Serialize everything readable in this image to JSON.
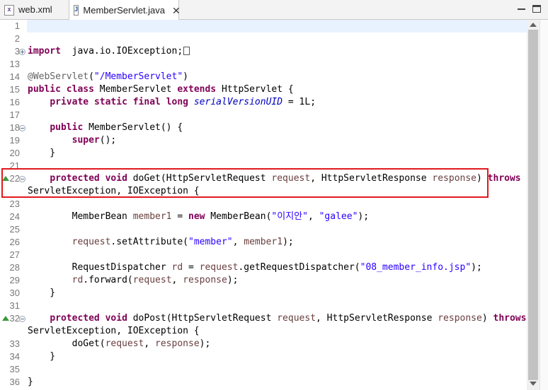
{
  "tabs": [
    {
      "label": "web.xml",
      "icon": "xml-file-icon",
      "active": false
    },
    {
      "label": "MemberServlet.java",
      "icon": "java-file-icon",
      "active": true
    }
  ],
  "lines": [
    {
      "n": "1"
    },
    {
      "n": "2"
    },
    {
      "n": "3",
      "segs": [
        [
          "kw",
          "import"
        ],
        [
          "",
          "  java.io.IOException;"
        ]
      ]
    },
    {
      "n": "13"
    },
    {
      "n": "14",
      "segs": [
        [
          "ann",
          "@WebServlet"
        ],
        [
          "",
          "("
        ],
        [
          "str",
          "\"/MemberServlet\""
        ],
        [
          "",
          ")"
        ]
      ]
    },
    {
      "n": "15",
      "segs": [
        [
          "kw",
          "public"
        ],
        [
          "",
          " "
        ],
        [
          "kw",
          "class"
        ],
        [
          "",
          " MemberServlet "
        ],
        [
          "kw",
          "extends"
        ],
        [
          "",
          " HttpServlet {"
        ]
      ]
    },
    {
      "n": "16",
      "segs": [
        [
          "",
          "    "
        ],
        [
          "kw",
          "private"
        ],
        [
          "",
          " "
        ],
        [
          "kw",
          "static"
        ],
        [
          "",
          " "
        ],
        [
          "kw",
          "final"
        ],
        [
          "",
          " "
        ],
        [
          "kw",
          "long"
        ],
        [
          "",
          " "
        ],
        [
          "fieldc",
          "serialVersionUID"
        ],
        [
          "",
          " = 1L;"
        ]
      ]
    },
    {
      "n": "17"
    },
    {
      "n": "18",
      "segs": [
        [
          "",
          "    "
        ],
        [
          "kw",
          "public"
        ],
        [
          "",
          " MemberServlet() {"
        ]
      ]
    },
    {
      "n": "19",
      "segs": [
        [
          "",
          "        "
        ],
        [
          "kw",
          "super"
        ],
        [
          "",
          "();"
        ]
      ]
    },
    {
      "n": "20",
      "segs": [
        [
          "",
          "    }"
        ]
      ]
    },
    {
      "n": "21"
    },
    {
      "n": "22",
      "segs": [
        [
          "",
          "    "
        ],
        [
          "kw",
          "protected"
        ],
        [
          "",
          " "
        ],
        [
          "kw",
          "void"
        ],
        [
          "",
          " doGet(HttpServletRequest "
        ],
        [
          "param",
          "request"
        ],
        [
          "",
          ", HttpServletResponse "
        ],
        [
          "param",
          "response"
        ],
        [
          "",
          ") "
        ],
        [
          "kw",
          "throws"
        ]
      ]
    },
    {
      "n": "",
      "segs": [
        [
          "",
          "ServletException, IOException {"
        ]
      ]
    },
    {
      "n": "23"
    },
    {
      "n": "24",
      "segs": [
        [
          "",
          "        MemberBean "
        ],
        [
          "param",
          "member1"
        ],
        [
          "",
          " = "
        ],
        [
          "kw",
          "new"
        ],
        [
          "",
          " MemberBean("
        ],
        [
          "str",
          "\"이지안\""
        ],
        [
          "",
          ", "
        ],
        [
          "str",
          "\"galee\""
        ],
        [
          "",
          ");"
        ]
      ]
    },
    {
      "n": "25"
    },
    {
      "n": "26",
      "segs": [
        [
          "",
          "        "
        ],
        [
          "param",
          "request"
        ],
        [
          "",
          ".setAttribute("
        ],
        [
          "str",
          "\"member\""
        ],
        [
          "",
          ", "
        ],
        [
          "param",
          "member1"
        ],
        [
          "",
          ");"
        ]
      ]
    },
    {
      "n": "27"
    },
    {
      "n": "28",
      "segs": [
        [
          "",
          "        RequestDispatcher "
        ],
        [
          "param",
          "rd"
        ],
        [
          "",
          " = "
        ],
        [
          "param",
          "request"
        ],
        [
          "",
          ".getRequestDispatcher("
        ],
        [
          "str",
          "\"08_member_info.jsp\""
        ],
        [
          "",
          ");"
        ]
      ]
    },
    {
      "n": "29",
      "segs": [
        [
          "",
          "        "
        ],
        [
          "param",
          "rd"
        ],
        [
          "",
          ".forward("
        ],
        [
          "param",
          "request"
        ],
        [
          "",
          ", "
        ],
        [
          "param",
          "response"
        ],
        [
          "",
          ");"
        ]
      ]
    },
    {
      "n": "30",
      "segs": [
        [
          "",
          "    }"
        ]
      ]
    },
    {
      "n": "31"
    },
    {
      "n": "32",
      "segs": [
        [
          "",
          "    "
        ],
        [
          "kw",
          "protected"
        ],
        [
          "",
          " "
        ],
        [
          "kw",
          "void"
        ],
        [
          "",
          " doPost(HttpServletRequest "
        ],
        [
          "param",
          "request"
        ],
        [
          "",
          ", HttpServletResponse "
        ],
        [
          "param",
          "response"
        ],
        [
          "",
          ") "
        ],
        [
          "kw",
          "throws"
        ]
      ]
    },
    {
      "n": "",
      "segs": [
        [
          "",
          "ServletException, IOException {"
        ]
      ]
    },
    {
      "n": "33",
      "segs": [
        [
          "",
          "        doGet("
        ],
        [
          "param",
          "request"
        ],
        [
          "",
          ", "
        ],
        [
          "param",
          "response"
        ],
        [
          "",
          ");"
        ]
      ]
    },
    {
      "n": "34",
      "segs": [
        [
          "",
          "    }"
        ]
      ]
    },
    {
      "n": "35"
    },
    {
      "n": "36",
      "segs": [
        [
          "",
          "}"
        ]
      ]
    }
  ]
}
